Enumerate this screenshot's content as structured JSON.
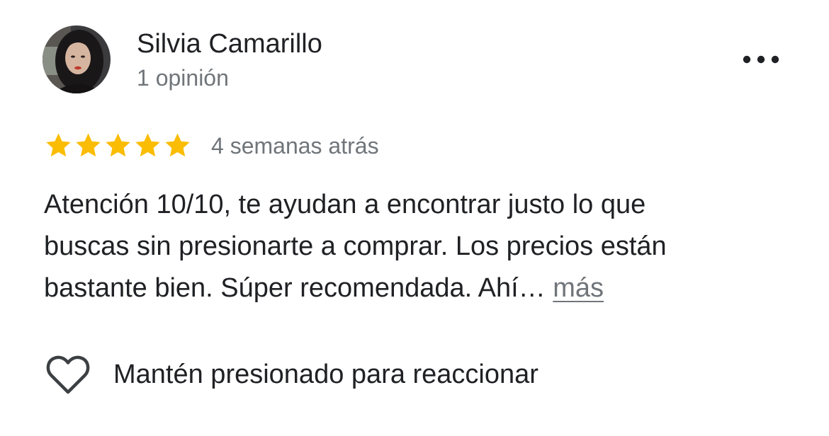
{
  "review": {
    "author": {
      "name": "Silvia Camarillo",
      "meta": "1 opinión",
      "avatar": "profile-photo"
    },
    "menu_icon": "more-horiz-icon",
    "rating": {
      "value": 5,
      "max": 5,
      "star_color": "#fbbc04",
      "timestamp": "4 semanas atrás"
    },
    "text_lines": [
      "Atención 10/10, te ayudan a encontrar justo lo que",
      "buscas sin presionarte a comprar. Los precios están",
      "bastante bien. Súper recomendada. Ahí…"
    ],
    "more_link": "más",
    "reaction": {
      "icon": "heart-outline-icon",
      "label": "Mantén presionado para reaccionar"
    }
  }
}
